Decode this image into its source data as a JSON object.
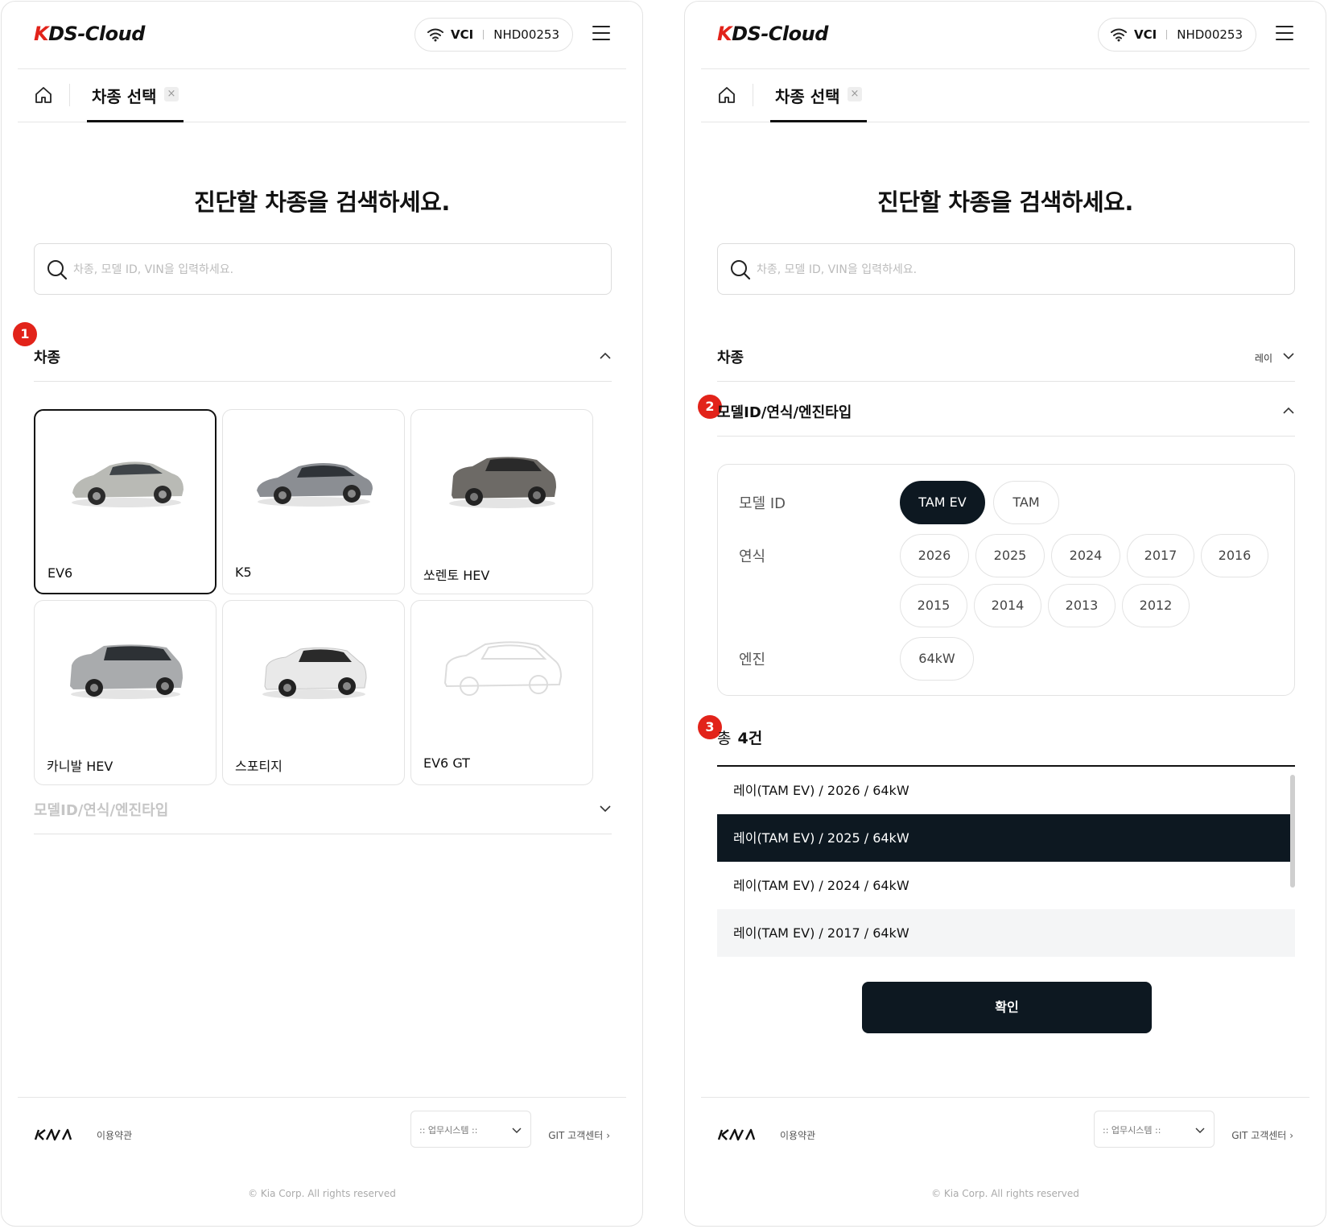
{
  "app": {
    "logo_k": "K",
    "logo_rest": "DS-Cloud",
    "vci_label": "VCI",
    "vci_id": "NHD00253"
  },
  "tab": {
    "label": "차종 선택",
    "close": "×"
  },
  "headline": "진단할 차종을 검색하세요.",
  "search": {
    "placeholder": "차종, 모델 ID, VIN을 입력하세요."
  },
  "left": {
    "badge": "1",
    "section_vehicle": "차종",
    "section_model": "모델ID/연식/엔진타입",
    "cards": [
      {
        "name": "EV6",
        "selected": true,
        "color": "#b9bab5"
      },
      {
        "name": "K5",
        "selected": false,
        "color": "#8b8e93"
      },
      {
        "name": "쏘렌토 HEV",
        "selected": false,
        "color": "#6d6a66"
      },
      {
        "name": "카니발 HEV",
        "selected": false,
        "color": "#a9abad"
      },
      {
        "name": "스포티지",
        "selected": false,
        "color": "#e6e6e6"
      },
      {
        "name": "EV6 GT",
        "selected": false,
        "color": "placeholder"
      }
    ]
  },
  "right": {
    "section_vehicle": "차종",
    "section_vehicle_value": "레이",
    "badge_model": "2",
    "section_model": "모델ID/연식/엔진타입",
    "labels": {
      "model_id": "모델 ID",
      "year": "연식",
      "engine": "엔진"
    },
    "model_ids": [
      "TAM EV",
      "TAM"
    ],
    "years": [
      "2026",
      "2025",
      "2024",
      "2017",
      "2016",
      "2015",
      "2014",
      "2013",
      "2012"
    ],
    "engines": [
      "64kW"
    ],
    "badge_count": "3",
    "count_prefix": "총",
    "count_value": "4건",
    "results": [
      "레이(TAM EV) / 2026 / 64kW",
      "레이(TAM EV) / 2025 / 64kW",
      "레이(TAM EV) / 2024 / 64kW",
      "레이(TAM EV) / 2017 / 64kW"
    ],
    "confirm": "확인"
  },
  "footer": {
    "terms": "이용약관",
    "system_select": ":: 업무시스템 ::",
    "git": "GIT 고객센터",
    "copyright": "© Kia Corp. All rights reserved"
  },
  "colors": {
    "brand_red": "#e2231a",
    "dark": "#0d1821",
    "border": "#e3e3e3"
  }
}
